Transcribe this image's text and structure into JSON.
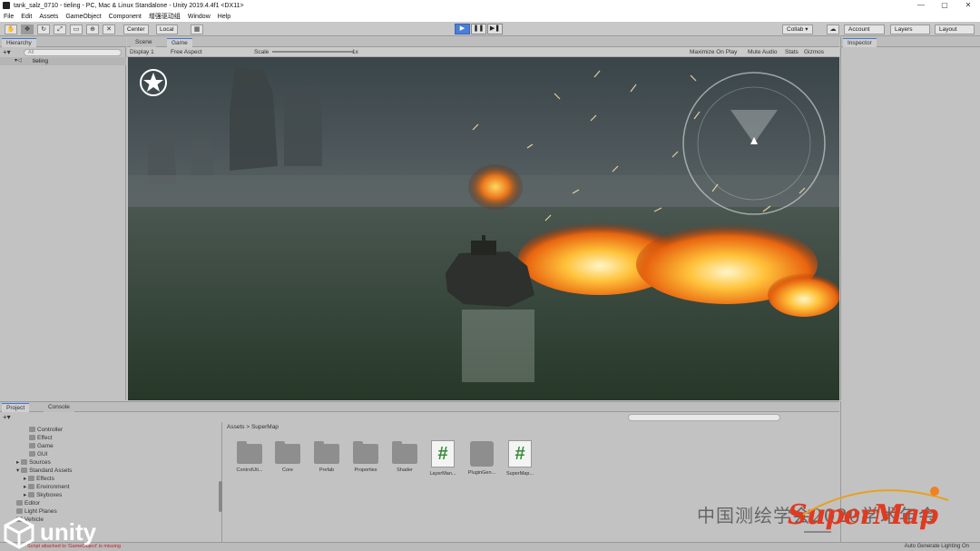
{
  "window": {
    "title": "tank_salz_0710 - tieling - PC, Mac & Linux Standalone - Unity 2019.4.4f1 <DX11>",
    "controls": [
      "—",
      "▢",
      "✕"
    ]
  },
  "menu": [
    "File",
    "Edit",
    "Assets",
    "GameObject",
    "Component",
    "增强驱动组",
    "Window",
    "Help"
  ],
  "toolbar": {
    "pivot_label": "Center",
    "space_label": "Local",
    "collab_label": "Collab ▾",
    "account_label": "Account",
    "layers_label": "Layers",
    "layout_label": "Layout"
  },
  "hierarchy": {
    "tab": "Hierarchy",
    "search_placeholder": "All",
    "scene_name": "tieling"
  },
  "game": {
    "tabs": [
      "Scene",
      "Game"
    ],
    "display": "Display 1",
    "aspect": "Free Aspect",
    "scale_label": "Scale",
    "scale_value": "1x",
    "maximize": "Maximize On Play",
    "mute": "Mute Audio",
    "stats": "Stats",
    "gizmos": "Gizmos"
  },
  "inspector": {
    "tab": "Inspector"
  },
  "project": {
    "tabs": [
      "Project",
      "Console"
    ],
    "breadcrumb": [
      "Assets",
      "SuperMap"
    ],
    "tree": [
      {
        "label": "Controller",
        "indent": 3
      },
      {
        "label": "Effect",
        "indent": 3
      },
      {
        "label": "Game",
        "indent": 3
      },
      {
        "label": "GUI",
        "indent": 3
      },
      {
        "label": "Sources",
        "indent": 2
      },
      {
        "label": "Standard Assets",
        "indent": 2
      },
      {
        "label": "Effects",
        "indent": 3
      },
      {
        "label": "Environment",
        "indent": 3
      },
      {
        "label": "Skyboxes",
        "indent": 3
      },
      {
        "label": "Editor",
        "indent": 1
      },
      {
        "label": "Light Planes",
        "indent": 1
      },
      {
        "label": "Vehicle",
        "indent": 1
      }
    ],
    "assets": [
      {
        "label": "ControlUti...",
        "kind": "folder"
      },
      {
        "label": "Core",
        "kind": "folder"
      },
      {
        "label": "Prefab",
        "kind": "folder"
      },
      {
        "label": "Properties",
        "kind": "folder"
      },
      {
        "label": "Shader",
        "kind": "folder"
      },
      {
        "label": "LayerMan...",
        "kind": "script"
      },
      {
        "label": "PluginGen...",
        "kind": "plugin"
      },
      {
        "label": "SuperMap...",
        "kind": "script"
      }
    ]
  },
  "status": {
    "error": "Script attached to 'GameObject' is missing",
    "right": "Auto Generate Lighting On"
  },
  "overlay": {
    "unity_logo": "unity",
    "watermark": "中国测绘学会2020学术年会",
    "brand": "SuperMap"
  },
  "colors": {
    "accent": "#3f7ad8",
    "brand": "#e03a20"
  }
}
